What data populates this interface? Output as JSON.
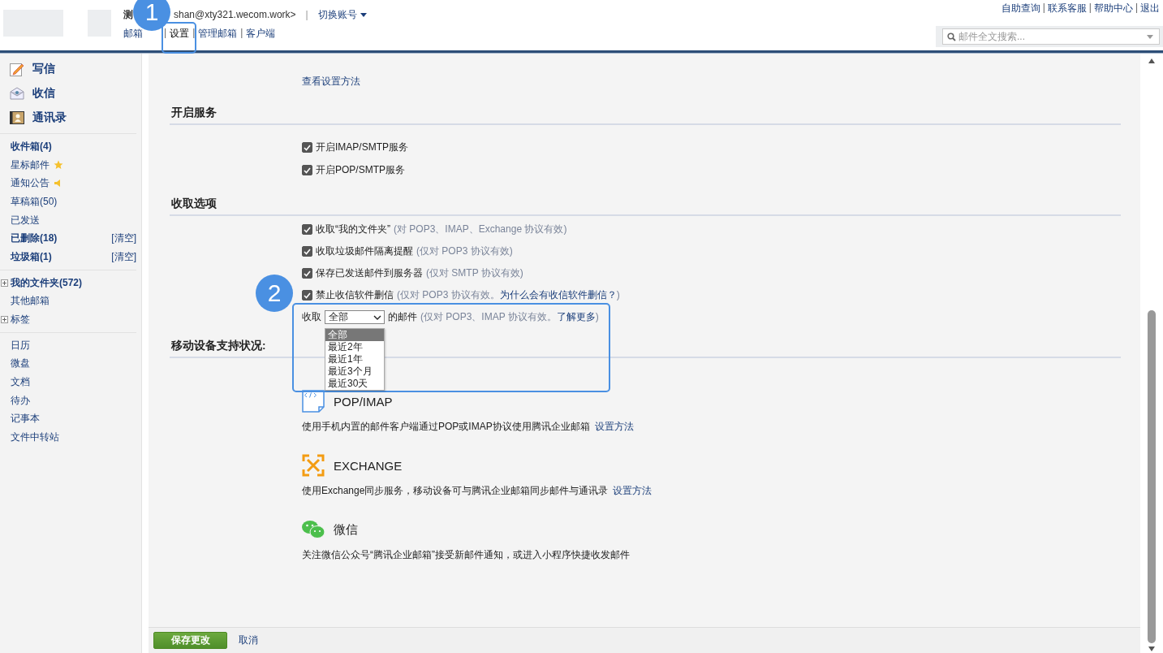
{
  "header": {
    "account_prefix": "测",
    "account_address": "shan@xty321.wecom.work>",
    "switch_account": "切换账号",
    "separator": "|",
    "nav": [
      {
        "label": "邮箱",
        "selected": false
      },
      {
        "label": "设置",
        "selected": true
      },
      {
        "label": "管理邮箱",
        "selected": false
      },
      {
        "label": "客户端",
        "selected": false
      }
    ],
    "top_links": [
      "自助查询",
      "联系客服",
      "帮助中心",
      "退出"
    ],
    "search": {
      "placeholder": "邮件全文搜索..."
    }
  },
  "sidebar": {
    "actions": [
      {
        "kind": "write",
        "label": "写信"
      },
      {
        "kind": "receive",
        "label": "收信"
      },
      {
        "kind": "contacts",
        "label": "通讯录"
      }
    ],
    "folders": [
      {
        "label": "收件箱(4)",
        "bold": true
      },
      {
        "label": "星标邮件",
        "bold": false,
        "kind": "star"
      },
      {
        "label": "通知公告",
        "bold": false,
        "kind": "speaker"
      },
      {
        "label": "草稿箱(50)",
        "bold": false
      },
      {
        "label": "已发送",
        "bold": false
      },
      {
        "label": "已删除(18)",
        "bold": true,
        "action": "[清空]"
      },
      {
        "label": "垃圾箱(1)",
        "bold": true,
        "action": "[清空]"
      }
    ],
    "groups": [
      {
        "label": "我的文件夹(572)",
        "bold": true,
        "expandable": true
      },
      {
        "label": "其他邮箱",
        "bold": false,
        "expandable": false
      },
      {
        "label": "标签",
        "bold": false,
        "expandable": true
      }
    ],
    "tools": [
      "日历",
      "微盘",
      "文档",
      "待办",
      "记事本",
      "文件中转站"
    ]
  },
  "settings": {
    "setup_link": "查看设置方法",
    "services": {
      "title": "开启服务",
      "options": [
        {
          "label": "开启IMAP/SMTP服务",
          "checked": true
        },
        {
          "label": "开启POP/SMTP服务",
          "checked": true
        }
      ]
    },
    "receive": {
      "title": "收取选项",
      "options": [
        {
          "label": "收取“我的文件夹”",
          "note": "(对 POP3、IMAP、Exchange 协议有效)",
          "checked": true
        },
        {
          "label": "收取垃圾邮件隔离提醒",
          "note": "(仅对 POP3 协议有效)",
          "checked": true
        },
        {
          "label": "保存已发送邮件到服务器",
          "note": "(仅对 SMTP 协议有效)",
          "checked": true
        },
        {
          "label": "禁止收信软件删信",
          "note": "(仅对 POP3 协议有效。",
          "link": "为什么会有收信软件删信？",
          "note_end": ")",
          "checked": true
        }
      ],
      "range": {
        "prefix": "收取",
        "value": "全部",
        "suffix": "的邮件",
        "note": "(仅对 POP3、IMAP 协议有效。",
        "link": "了解更多",
        "note_end": ")",
        "options": [
          {
            "label": "全部",
            "selected": true
          },
          {
            "label": "最近2年",
            "selected": false
          },
          {
            "label": "最近1年",
            "selected": false
          },
          {
            "label": "最近3个月",
            "selected": false
          },
          {
            "label": "最近30天",
            "selected": false
          }
        ]
      }
    },
    "mobile": {
      "title": "移动设备支持状况:",
      "items": [
        {
          "kind": "pop",
          "name": "POP/IMAP",
          "description": "使用手机内置的邮件客户端通过POP或IMAP协议使用腾讯企业邮箱",
          "link": "设置方法"
        },
        {
          "kind": "exchange",
          "name": "EXCHANGE",
          "description": "使用Exchange同步服务，移动设备可与腾讯企业邮箱同步邮件与通讯录",
          "link": "设置方法"
        },
        {
          "kind": "wechat",
          "name": "微信",
          "description": "关注微信公众号“腾讯企业邮箱”接受新邮件通知，或进入小程序快捷收发邮件"
        }
      ]
    }
  },
  "footer": {
    "save": "保存更改",
    "cancel": "取消"
  },
  "callouts": [
    "1",
    "2"
  ]
}
